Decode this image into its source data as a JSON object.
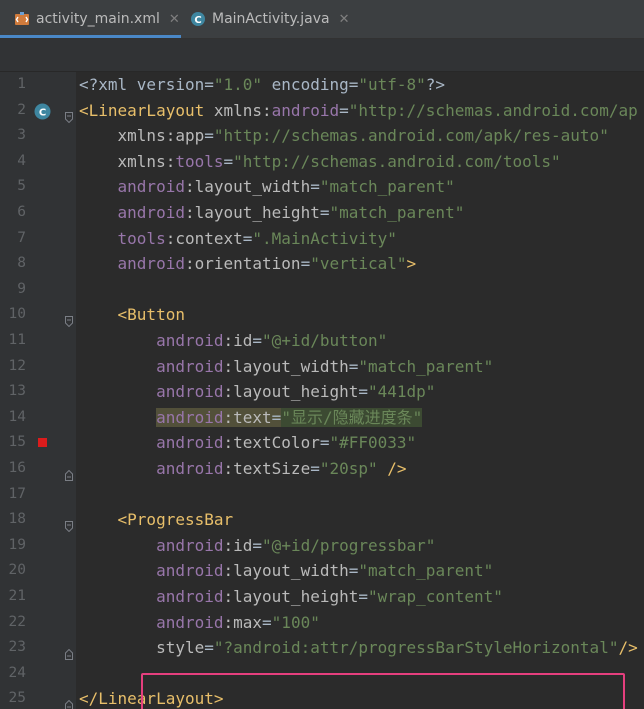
{
  "tabs": [
    {
      "label": "activity_main.xml",
      "icon": "xml-file-icon",
      "active": true,
      "close": "✕"
    },
    {
      "label": "MainActivity.java",
      "icon": "java-class-icon",
      "active": false,
      "close": "✕"
    }
  ],
  "gutter": {
    "class_marker": "C"
  },
  "lines": [
    {
      "n": "1",
      "tokens": [
        [
          "t-plain",
          "<?xml version="
        ],
        [
          "t-val",
          "\"1.0\""
        ],
        [
          "t-plain",
          " encoding="
        ],
        [
          "t-val",
          "\"utf-8\""
        ],
        [
          "t-plain",
          "?>"
        ]
      ]
    },
    {
      "n": "2",
      "tokens": [
        [
          "t-tag",
          "<LinearLayout "
        ],
        [
          "t-attr",
          "xmlns:"
        ],
        [
          "t-ns",
          "android"
        ],
        [
          "t-plain",
          "="
        ],
        [
          "t-val",
          "\"http://schemas.android.com/ap"
        ]
      ]
    },
    {
      "n": "3",
      "tokens": [
        [
          "t-plain",
          "    "
        ],
        [
          "t-attr",
          "xmlns:app"
        ],
        [
          "t-plain",
          "="
        ],
        [
          "t-val",
          "\"http://schemas.android.com/apk/res-auto\""
        ]
      ]
    },
    {
      "n": "4",
      "tokens": [
        [
          "t-plain",
          "    "
        ],
        [
          "t-attr",
          "xmlns:"
        ],
        [
          "t-ns",
          "tools"
        ],
        [
          "t-plain",
          "="
        ],
        [
          "t-val",
          "\"http://schemas.android.com/tools\""
        ]
      ]
    },
    {
      "n": "5",
      "tokens": [
        [
          "t-plain",
          "    "
        ],
        [
          "t-ns",
          "android"
        ],
        [
          "t-attr",
          ":layout_width"
        ],
        [
          "t-plain",
          "="
        ],
        [
          "t-val",
          "\"match_parent\""
        ]
      ]
    },
    {
      "n": "6",
      "tokens": [
        [
          "t-plain",
          "    "
        ],
        [
          "t-ns",
          "android"
        ],
        [
          "t-attr",
          ":layout_height"
        ],
        [
          "t-plain",
          "="
        ],
        [
          "t-val",
          "\"match_parent\""
        ]
      ]
    },
    {
      "n": "7",
      "tokens": [
        [
          "t-plain",
          "    "
        ],
        [
          "t-ns",
          "tools"
        ],
        [
          "t-attr",
          ":context"
        ],
        [
          "t-plain",
          "="
        ],
        [
          "t-val",
          "\".MainActivity\""
        ]
      ]
    },
    {
      "n": "8",
      "tokens": [
        [
          "t-plain",
          "    "
        ],
        [
          "t-ns",
          "android"
        ],
        [
          "t-attr",
          ":orientation"
        ],
        [
          "t-plain",
          "="
        ],
        [
          "t-val",
          "\"vertical\""
        ],
        [
          "t-tag",
          ">"
        ]
      ]
    },
    {
      "n": "9",
      "tokens": []
    },
    {
      "n": "10",
      "tokens": [
        [
          "t-plain",
          "    "
        ],
        [
          "t-tag",
          "<Button"
        ]
      ]
    },
    {
      "n": "11",
      "tokens": [
        [
          "t-plain",
          "        "
        ],
        [
          "t-ns",
          "android"
        ],
        [
          "t-attr",
          ":id"
        ],
        [
          "t-plain",
          "="
        ],
        [
          "t-val",
          "\"@+id/button\""
        ]
      ]
    },
    {
      "n": "12",
      "tokens": [
        [
          "t-plain",
          "        "
        ],
        [
          "t-ns",
          "android"
        ],
        [
          "t-attr",
          ":layout_width"
        ],
        [
          "t-plain",
          "="
        ],
        [
          "t-val",
          "\"match_parent\""
        ]
      ]
    },
    {
      "n": "13",
      "tokens": [
        [
          "t-plain",
          "        "
        ],
        [
          "t-ns",
          "android"
        ],
        [
          "t-attr",
          ":layout_height"
        ],
        [
          "t-plain",
          "="
        ],
        [
          "t-val",
          "\"441dp\""
        ]
      ]
    },
    {
      "n": "14",
      "tokens": [
        [
          "t-plain",
          "        "
        ],
        [
          "t-ns hl",
          "android"
        ],
        [
          "t-attr hl",
          ":text"
        ],
        [
          "t-plain hl",
          "="
        ],
        [
          "t-val hl",
          "\"显示/隐藏进度条\""
        ]
      ]
    },
    {
      "n": "15",
      "tokens": [
        [
          "t-plain",
          "        "
        ],
        [
          "t-ns",
          "android"
        ],
        [
          "t-attr",
          ":textColor"
        ],
        [
          "t-plain",
          "="
        ],
        [
          "t-val",
          "\"#FF0033\""
        ]
      ]
    },
    {
      "n": "16",
      "tokens": [
        [
          "t-plain",
          "        "
        ],
        [
          "t-ns",
          "android"
        ],
        [
          "t-attr",
          ":textSize"
        ],
        [
          "t-plain",
          "="
        ],
        [
          "t-val",
          "\"20sp\""
        ],
        [
          "t-plain",
          " "
        ],
        [
          "t-tag",
          "/>"
        ]
      ]
    },
    {
      "n": "17",
      "tokens": []
    },
    {
      "n": "18",
      "tokens": [
        [
          "t-plain",
          "    "
        ],
        [
          "t-tag",
          "<ProgressBar"
        ]
      ]
    },
    {
      "n": "19",
      "tokens": [
        [
          "t-plain",
          "        "
        ],
        [
          "t-ns",
          "android"
        ],
        [
          "t-attr",
          ":id"
        ],
        [
          "t-plain",
          "="
        ],
        [
          "t-val",
          "\"@+id/progressbar\""
        ]
      ]
    },
    {
      "n": "20",
      "tokens": [
        [
          "t-plain",
          "        "
        ],
        [
          "t-ns",
          "android"
        ],
        [
          "t-attr",
          ":layout_width"
        ],
        [
          "t-plain",
          "="
        ],
        [
          "t-val",
          "\"match_parent\""
        ]
      ]
    },
    {
      "n": "21",
      "tokens": [
        [
          "t-plain",
          "        "
        ],
        [
          "t-ns",
          "android"
        ],
        [
          "t-attr",
          ":layout_height"
        ],
        [
          "t-plain",
          "="
        ],
        [
          "t-val",
          "\"wrap_content\""
        ]
      ]
    },
    {
      "n": "22",
      "tokens": [
        [
          "t-plain",
          "        "
        ],
        [
          "t-ns",
          "android"
        ],
        [
          "t-attr",
          ":max"
        ],
        [
          "t-plain",
          "="
        ],
        [
          "t-val",
          "\"100\""
        ]
      ]
    },
    {
      "n": "23",
      "tokens": [
        [
          "t-plain",
          "        "
        ],
        [
          "t-attr",
          "style"
        ],
        [
          "t-plain",
          "="
        ],
        [
          "t-val",
          "\"?android:attr/progressBarStyleHorizontal\""
        ],
        [
          "t-tag",
          "/>"
        ]
      ]
    },
    {
      "n": "24",
      "tokens": []
    },
    {
      "n": "25",
      "tokens": [
        [
          "t-tag",
          "</LinearLayout>"
        ]
      ]
    }
  ],
  "colors": {
    "highlight_box": "#e53f7e",
    "breakpoint": "#db1c1c",
    "active_tab_underline": "#4a88c7"
  }
}
